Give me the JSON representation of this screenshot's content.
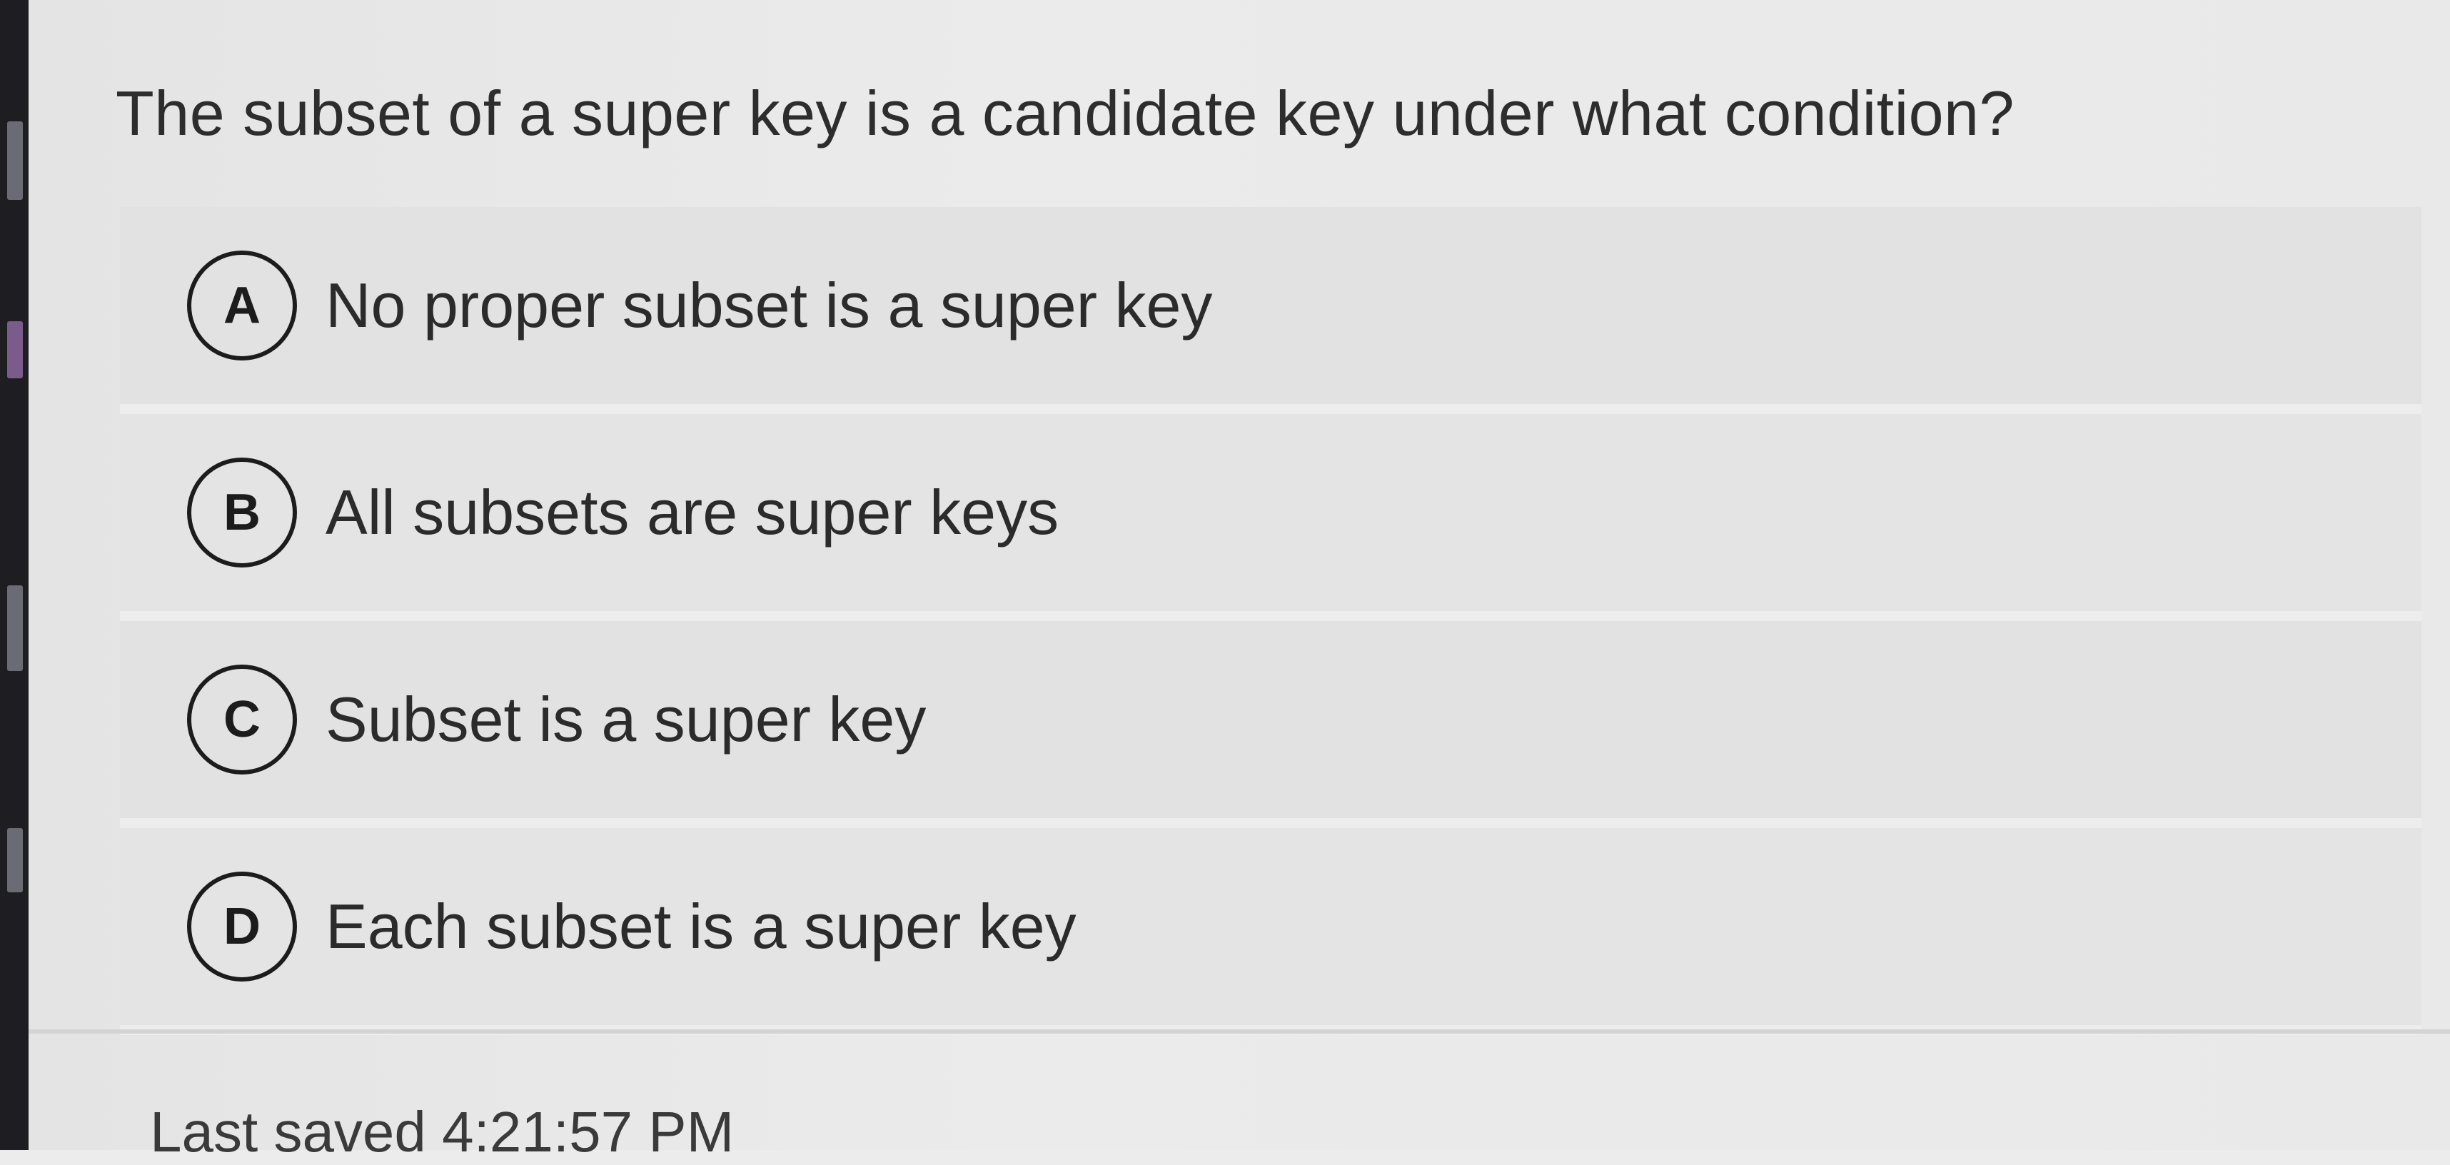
{
  "question": {
    "text": "The subset of a super key is a candidate key under what condition?"
  },
  "options": [
    {
      "letter": "A",
      "text": "No proper subset is a super key"
    },
    {
      "letter": "B",
      "text": "All subsets are super keys"
    },
    {
      "letter": "C",
      "text": "Subset is a super key"
    },
    {
      "letter": "D",
      "text": "Each subset is a super key"
    }
  ],
  "footer": {
    "status": "Last saved 4:21:57 PM"
  },
  "colors": {
    "background": "#ececec",
    "option_background": "#e2e2e2",
    "text": "#2b2b2b"
  }
}
